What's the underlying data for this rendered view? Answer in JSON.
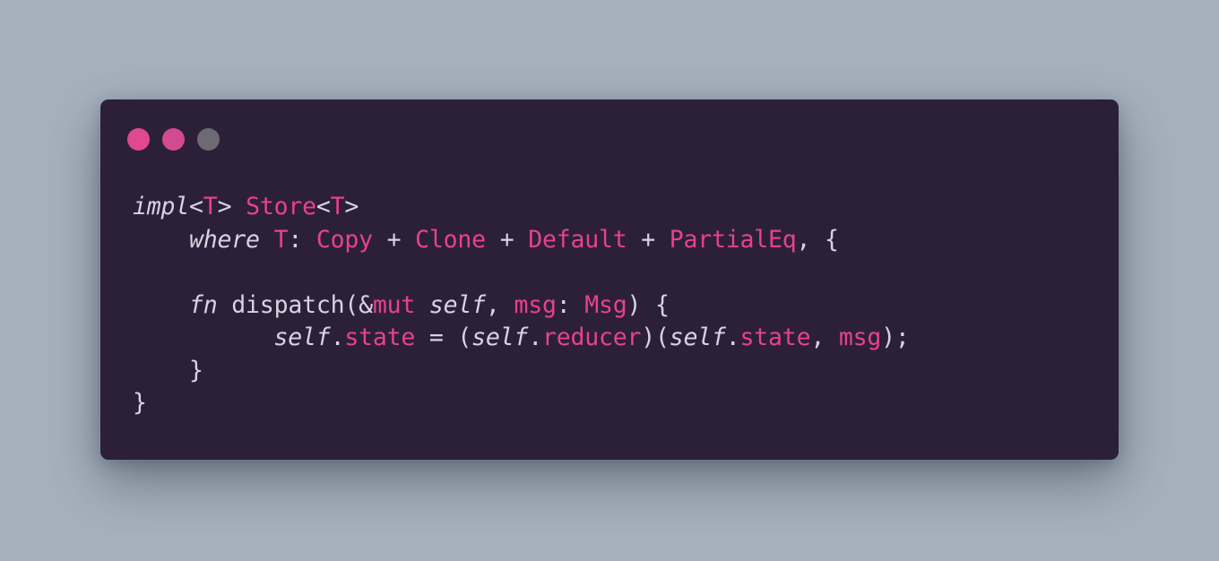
{
  "window": {
    "controls": [
      {
        "name": "close",
        "color": "#e04890"
      },
      {
        "name": "minimize",
        "color": "#d24a92"
      },
      {
        "name": "maximize",
        "color": "#6e6a74"
      }
    ]
  },
  "colors": {
    "background": "#a6b1bd",
    "editor": "#2c2039",
    "text": "#d9d3e0",
    "accent": "#e7418f"
  },
  "code_lines": [
    [
      {
        "t": "impl",
        "c": "kw"
      },
      {
        "t": "<",
        "c": "pl"
      },
      {
        "t": "T",
        "c": "ty"
      },
      {
        "t": "> ",
        "c": "pl"
      },
      {
        "t": "Store",
        "c": "ty"
      },
      {
        "t": "<",
        "c": "pl"
      },
      {
        "t": "T",
        "c": "ty"
      },
      {
        "t": ">",
        "c": "pl"
      }
    ],
    [
      {
        "t": "    ",
        "c": "pl"
      },
      {
        "t": "where",
        "c": "kw"
      },
      {
        "t": " ",
        "c": "pl"
      },
      {
        "t": "T",
        "c": "ty"
      },
      {
        "t": ": ",
        "c": "pl"
      },
      {
        "t": "Copy",
        "c": "ty"
      },
      {
        "t": " + ",
        "c": "pl"
      },
      {
        "t": "Clone",
        "c": "ty"
      },
      {
        "t": " + ",
        "c": "pl"
      },
      {
        "t": "Default",
        "c": "ty"
      },
      {
        "t": " + ",
        "c": "pl"
      },
      {
        "t": "PartialEq",
        "c": "ty"
      },
      {
        "t": ", {",
        "c": "pl"
      }
    ],
    [],
    [
      {
        "t": "    ",
        "c": "pl"
      },
      {
        "t": "fn",
        "c": "kw"
      },
      {
        "t": " dispatch(&",
        "c": "pl"
      },
      {
        "t": "mut",
        "c": "ty"
      },
      {
        "t": " ",
        "c": "pl"
      },
      {
        "t": "self",
        "c": "sl"
      },
      {
        "t": ", ",
        "c": "pl"
      },
      {
        "t": "msg",
        "c": "ty"
      },
      {
        "t": ": ",
        "c": "pl"
      },
      {
        "t": "Msg",
        "c": "ty"
      },
      {
        "t": ") {",
        "c": "pl"
      }
    ],
    [
      {
        "t": "          ",
        "c": "pl"
      },
      {
        "t": "self",
        "c": "sl"
      },
      {
        "t": ".",
        "c": "pl"
      },
      {
        "t": "state",
        "c": "ty"
      },
      {
        "t": " = (",
        "c": "pl"
      },
      {
        "t": "self",
        "c": "sl"
      },
      {
        "t": ".",
        "c": "pl"
      },
      {
        "t": "reducer",
        "c": "ty"
      },
      {
        "t": ")(",
        "c": "pl"
      },
      {
        "t": "self",
        "c": "sl"
      },
      {
        "t": ".",
        "c": "pl"
      },
      {
        "t": "state",
        "c": "ty"
      },
      {
        "t": ", ",
        "c": "pl"
      },
      {
        "t": "msg",
        "c": "ty"
      },
      {
        "t": ");",
        "c": "pl"
      }
    ],
    [
      {
        "t": "    }",
        "c": "pl"
      }
    ],
    [
      {
        "t": "}",
        "c": "pl"
      }
    ]
  ]
}
